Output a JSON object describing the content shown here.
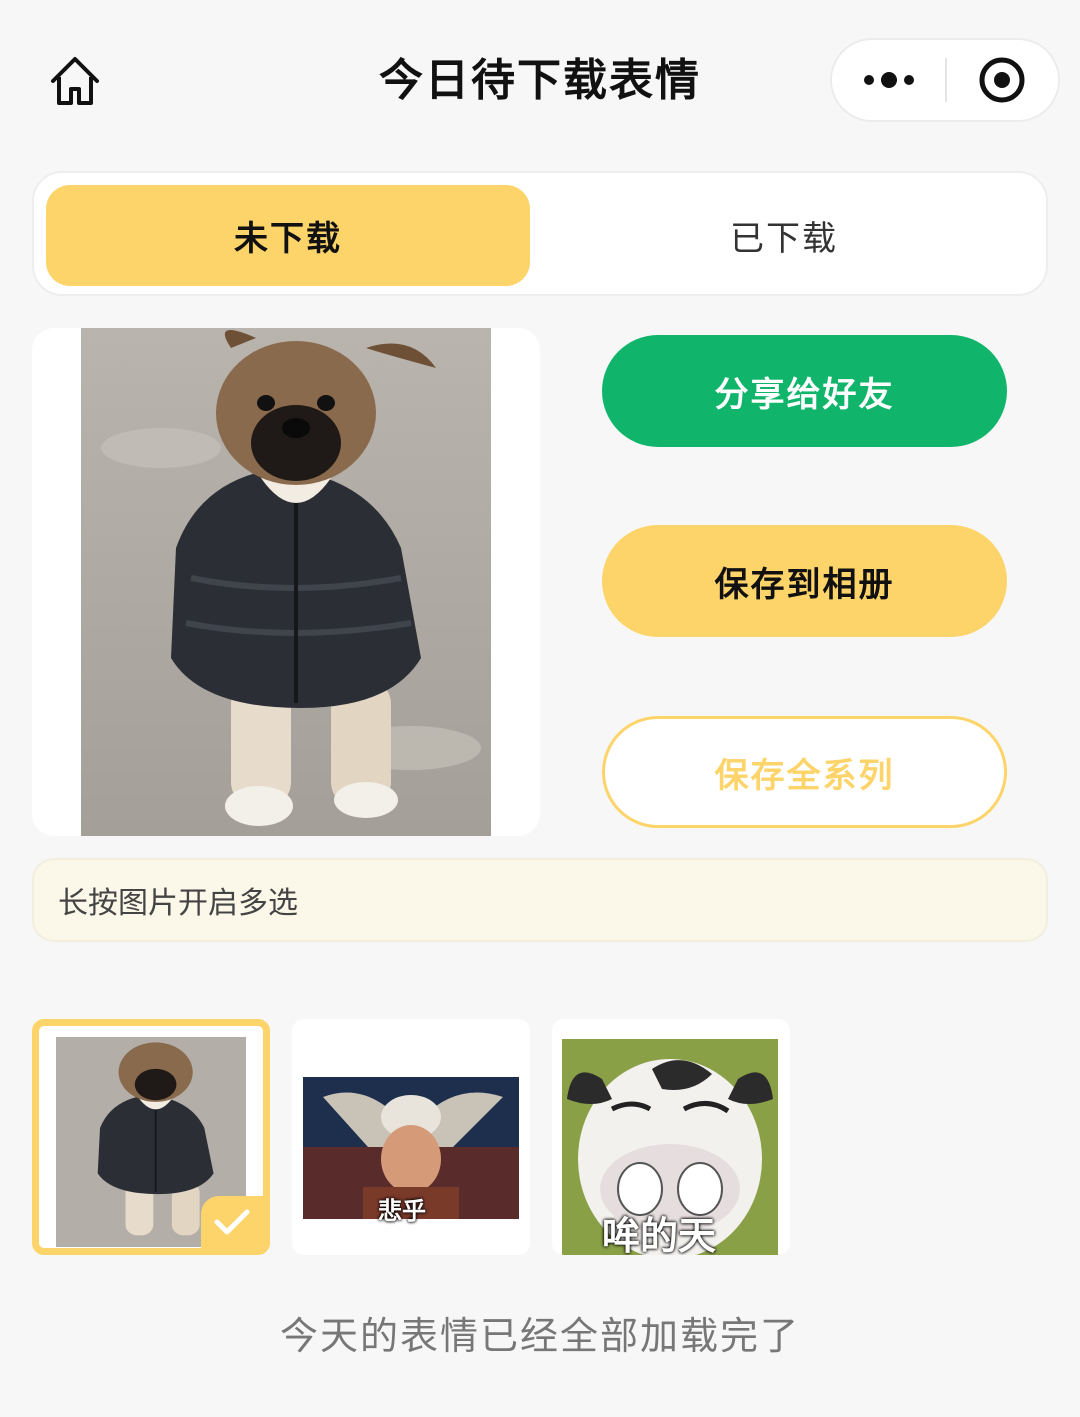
{
  "header": {
    "title": "今日待下载表情"
  },
  "tabs": [
    {
      "label": "未下载",
      "active": true
    },
    {
      "label": "已下载",
      "active": false
    }
  ],
  "actions": {
    "share_label": "分享给好友",
    "save_label": "保存到相册",
    "save_series_label": "保存全系列"
  },
  "hint": "长按图片开启多选",
  "thumbnails": [
    {
      "subject": "puppy in puffer jacket",
      "selected": true,
      "caption": ""
    },
    {
      "subject": "man in hat meme",
      "selected": false,
      "caption": "悲乎"
    },
    {
      "subject": "cartoon cow meme",
      "selected": false,
      "caption": "哞的天"
    }
  ],
  "footer": "今天的表情已经全部加载完了",
  "colors": {
    "accent_yellow": "#fdd46a",
    "share_green": "#10b56b",
    "hint_bg": "#fbf7e9"
  },
  "icons": {
    "home": "home-icon",
    "more": "more-dots-icon",
    "close_target": "target-icon",
    "check": "check-icon"
  }
}
